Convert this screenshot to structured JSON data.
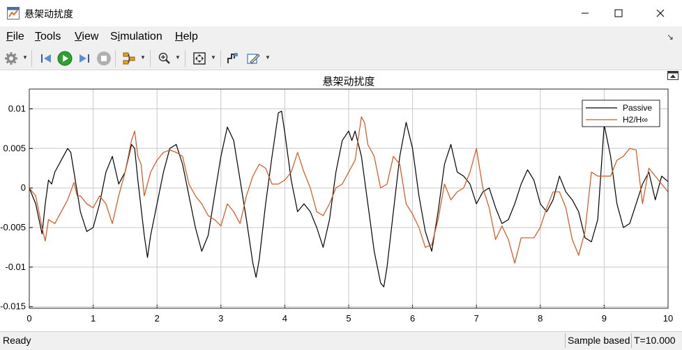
{
  "window": {
    "title": "悬架动扰度",
    "controls": {
      "minimize": "minimize",
      "maximize": "maximize",
      "close": "close"
    }
  },
  "menu": {
    "items": [
      {
        "label": "File",
        "accel": "F"
      },
      {
        "label": "Tools",
        "accel": "T"
      },
      {
        "label": "View",
        "accel": "V"
      },
      {
        "label": "Simulation",
        "accel": "i"
      },
      {
        "label": "Help",
        "accel": "H"
      }
    ]
  },
  "toolbar": {
    "buttons": [
      {
        "name": "settings-button",
        "icon": "gear-icon"
      },
      {
        "name": "step-back-button",
        "icon": "step-back-icon"
      },
      {
        "name": "run-button",
        "icon": "play-icon"
      },
      {
        "name": "step-forward-button",
        "icon": "step-forward-icon"
      },
      {
        "name": "stop-button",
        "icon": "stop-icon"
      },
      {
        "name": "highlight-button",
        "icon": "highlight-signal-icon"
      },
      {
        "name": "zoom-button",
        "icon": "zoom-in-icon"
      },
      {
        "name": "fit-view-button",
        "icon": "fit-to-view-icon"
      },
      {
        "name": "cursor-measure-button",
        "icon": "cursor-measure-icon"
      },
      {
        "name": "style-button",
        "icon": "style-icon"
      }
    ],
    "colors": {
      "play": "#2ea02e",
      "stop": "#9a9a9a"
    }
  },
  "status": {
    "ready": "Ready",
    "sample": "Sample based",
    "time": "T=10.000"
  },
  "chart_data": {
    "type": "line",
    "title": "悬架动扰度",
    "xlabel": "",
    "ylabel": "",
    "xlim": [
      0,
      10
    ],
    "ylim": [
      -0.0152,
      0.0125
    ],
    "x_ticks": [
      0,
      1,
      2,
      3,
      4,
      5,
      6,
      7,
      8,
      9,
      10
    ],
    "x_tick_labels": [
      "0",
      "1",
      "2",
      "3",
      "4",
      "5",
      "6",
      "7",
      "8",
      "9",
      "10"
    ],
    "y_ticks": [
      0.01,
      0.005,
      0,
      -0.005,
      -0.01,
      -0.015
    ],
    "y_tick_labels": [
      "0.01",
      "0.005",
      "0",
      "-0.005",
      "-0.01",
      "-0.015"
    ],
    "grid": true,
    "legend_position": "top-right",
    "series": [
      {
        "name": "Passive",
        "color": "#000000",
        "x": [
          0,
          0.1,
          0.2,
          0.25,
          0.3,
          0.35,
          0.4,
          0.5,
          0.6,
          0.65,
          0.7,
          0.8,
          0.9,
          1.0,
          1.1,
          1.2,
          1.3,
          1.4,
          1.5,
          1.6,
          1.65,
          1.7,
          1.8,
          1.85,
          1.9,
          2.0,
          2.1,
          2.2,
          2.3,
          2.4,
          2.5,
          2.6,
          2.7,
          2.8,
          2.9,
          3.0,
          3.1,
          3.2,
          3.3,
          3.4,
          3.5,
          3.55,
          3.6,
          3.7,
          3.8,
          3.9,
          3.95,
          4.0,
          4.1,
          4.2,
          4.3,
          4.4,
          4.5,
          4.6,
          4.7,
          4.8,
          4.9,
          5.0,
          5.05,
          5.1,
          5.2,
          5.3,
          5.4,
          5.5,
          5.55,
          5.6,
          5.7,
          5.8,
          5.9,
          6.0,
          6.1,
          6.2,
          6.3,
          6.4,
          6.5,
          6.6,
          6.7,
          6.8,
          6.9,
          7.0,
          7.1,
          7.2,
          7.3,
          7.4,
          7.5,
          7.6,
          7.7,
          7.8,
          7.9,
          8.0,
          8.1,
          8.2,
          8.3,
          8.4,
          8.5,
          8.6,
          8.7,
          8.8,
          8.9,
          9.0,
          9.1,
          9.2,
          9.3,
          9.4,
          9.5,
          9.6,
          9.7,
          9.8,
          9.9,
          10.0
        ],
        "y": [
          0,
          -0.002,
          -0.0058,
          -0.002,
          0.001,
          0.0005,
          0.002,
          0.0035,
          0.005,
          0.0045,
          0.002,
          -0.003,
          -0.0055,
          -0.005,
          -0.002,
          0.002,
          0.004,
          0.0005,
          0.002,
          0.0055,
          0.005,
          0.001,
          -0.006,
          -0.0088,
          -0.006,
          -0.002,
          0.002,
          0.005,
          0.0055,
          0.003,
          -0.001,
          -0.005,
          -0.008,
          -0.006,
          -0.001,
          0.004,
          0.0077,
          0.006,
          0.001,
          -0.004,
          -0.0095,
          -0.0113,
          -0.009,
          -0.002,
          0.004,
          0.0095,
          0.0097,
          0.007,
          0.001,
          -0.003,
          -0.002,
          -0.003,
          -0.005,
          -0.0075,
          -0.004,
          0.002,
          0.006,
          0.0072,
          0.006,
          0.0072,
          0.004,
          -0.002,
          -0.008,
          -0.012,
          -0.0125,
          -0.01,
          -0.003,
          0.004,
          0.0083,
          0.005,
          -0.001,
          -0.0055,
          -0.008,
          -0.003,
          0.003,
          0.0055,
          0.002,
          0.0015,
          0.0005,
          -0.002,
          -0.0005,
          0,
          -0.0025,
          -0.0045,
          -0.004,
          -0.002,
          0.0005,
          0.0023,
          0.001,
          -0.002,
          -0.003,
          -0.0015,
          0.0015,
          -0.0005,
          -0.0015,
          -0.003,
          -0.0063,
          -0.0068,
          -0.004,
          0.008,
          0.004,
          -0.002,
          -0.005,
          -0.0045,
          -0.002,
          0.0005,
          0.002,
          -0.0015,
          0.0015,
          0.0008
        ]
      },
      {
        "name": "H2/H∞",
        "color": "#d95319",
        "x": [
          0,
          0.1,
          0.2,
          0.25,
          0.3,
          0.4,
          0.5,
          0.6,
          0.7,
          0.75,
          0.8,
          0.9,
          1.0,
          1.1,
          1.2,
          1.3,
          1.4,
          1.5,
          1.6,
          1.65,
          1.7,
          1.75,
          1.8,
          1.9,
          2.0,
          2.1,
          2.2,
          2.3,
          2.4,
          2.5,
          2.6,
          2.7,
          2.8,
          2.9,
          3.0,
          3.1,
          3.2,
          3.3,
          3.4,
          3.5,
          3.6,
          3.7,
          3.8,
          3.9,
          4.0,
          4.1,
          4.2,
          4.3,
          4.4,
          4.5,
          4.6,
          4.7,
          4.8,
          4.9,
          5.0,
          5.1,
          5.2,
          5.25,
          5.3,
          5.4,
          5.5,
          5.6,
          5.7,
          5.8,
          5.9,
          6.0,
          6.1,
          6.2,
          6.3,
          6.4,
          6.5,
          6.6,
          6.7,
          6.8,
          6.9,
          7.0,
          7.1,
          7.2,
          7.3,
          7.4,
          7.5,
          7.6,
          7.7,
          7.8,
          7.9,
          8.0,
          8.1,
          8.2,
          8.3,
          8.4,
          8.5,
          8.6,
          8.7,
          8.8,
          8.9,
          9.0,
          9.1,
          9.2,
          9.3,
          9.4,
          9.5,
          9.6,
          9.7,
          9.8,
          9.9,
          10.0
        ],
        "y": [
          0,
          -0.001,
          -0.005,
          -0.0067,
          -0.004,
          -0.0045,
          -0.003,
          -0.0015,
          0.0007,
          -0.001,
          -0.001,
          -0.002,
          -0.0025,
          -0.001,
          -0.002,
          -0.0045,
          -0.001,
          0.002,
          0.006,
          0.0072,
          0.004,
          0.003,
          -0.001,
          0.002,
          0.0035,
          0.0045,
          0.0048,
          0.0045,
          0.004,
          0.0005,
          -0.001,
          -0.002,
          -0.0035,
          -0.004,
          -0.0048,
          -0.002,
          -0.003,
          -0.0045,
          -0.001,
          0.0015,
          0.003,
          0.0025,
          0.0005,
          0.0005,
          0.001,
          0.002,
          0.0045,
          0.002,
          0,
          -0.003,
          -0.0035,
          -0.002,
          0,
          0.0005,
          0.002,
          0.0035,
          0.009,
          0.0082,
          0.0055,
          0.004,
          0,
          0.0005,
          0.004,
          0.003,
          -0.002,
          -0.0033,
          -0.005,
          -0.0075,
          -0.0072,
          -0.004,
          0.0005,
          -0.0015,
          -0.0005,
          0,
          0.002,
          0.005,
          0,
          -0.0025,
          -0.0065,
          -0.0048,
          -0.0065,
          -0.0095,
          -0.0063,
          -0.0063,
          -0.0063,
          -0.005,
          -0.0025,
          -0.0005,
          -0.0005,
          -0.0025,
          -0.0065,
          -0.0085,
          -0.0055,
          0.002,
          0.0015,
          0.0015,
          0.0015,
          0.0035,
          0.004,
          0.005,
          0.0048,
          -0.002,
          0.0025,
          0.0015,
          0.0005,
          -0.0005
        ]
      }
    ]
  }
}
